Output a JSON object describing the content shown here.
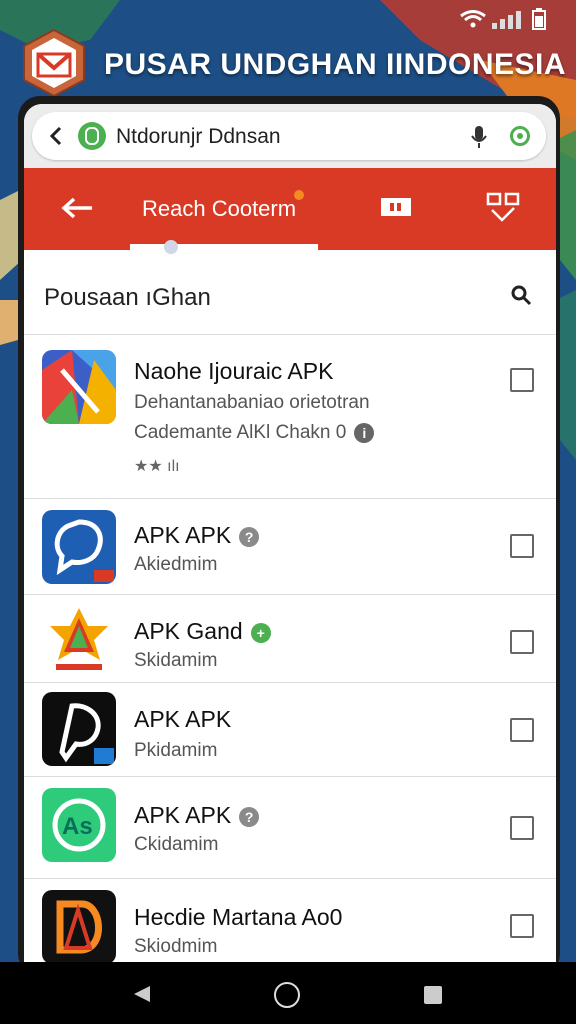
{
  "banner": {
    "title": "PUSAR UNDGHAN IINDONESIA",
    "logo": "envelope-logo"
  },
  "browser": {
    "url_text": "Ntdorunjr Ddnsan",
    "icons": [
      "back-icon",
      "shield-icon",
      "mic-icon",
      "target-icon"
    ]
  },
  "appbar": {
    "title": "Reach Cooterm",
    "icons": [
      "back-arrow-icon",
      "tag-icon",
      "swap-icon"
    ]
  },
  "section": {
    "title": "Pousaan ıGhan",
    "icon": "search-icon"
  },
  "items": [
    {
      "title": "Naohe Ijouraic APK",
      "line1": "Dehantanabaniao orietotran",
      "line2": "Cademante AlKl Chakn 0",
      "rating_text": "★★ ılı",
      "checked": false
    },
    {
      "title": "APK APK",
      "sub": "Akiedmim",
      "badge": "?",
      "badge_color": "#8a8a8a",
      "checked": false
    },
    {
      "title": "APK Gand",
      "sub": "Skidamim",
      "badge": "+",
      "badge_color": "#4caf50",
      "checked": false
    },
    {
      "title": "APK APK",
      "sub": "Pkidamim",
      "badge": "",
      "checked": false
    },
    {
      "title": "APK APK",
      "sub": "Ckidamim",
      "badge": "?",
      "badge_color": "#8a8a8a",
      "checked": false
    },
    {
      "title": "Hecdie Martana Ao0",
      "sub": "Skiodmim",
      "badge": "",
      "checked": false
    }
  ],
  "colors": {
    "accent": "#d93a26",
    "background": "#1d4f86"
  }
}
